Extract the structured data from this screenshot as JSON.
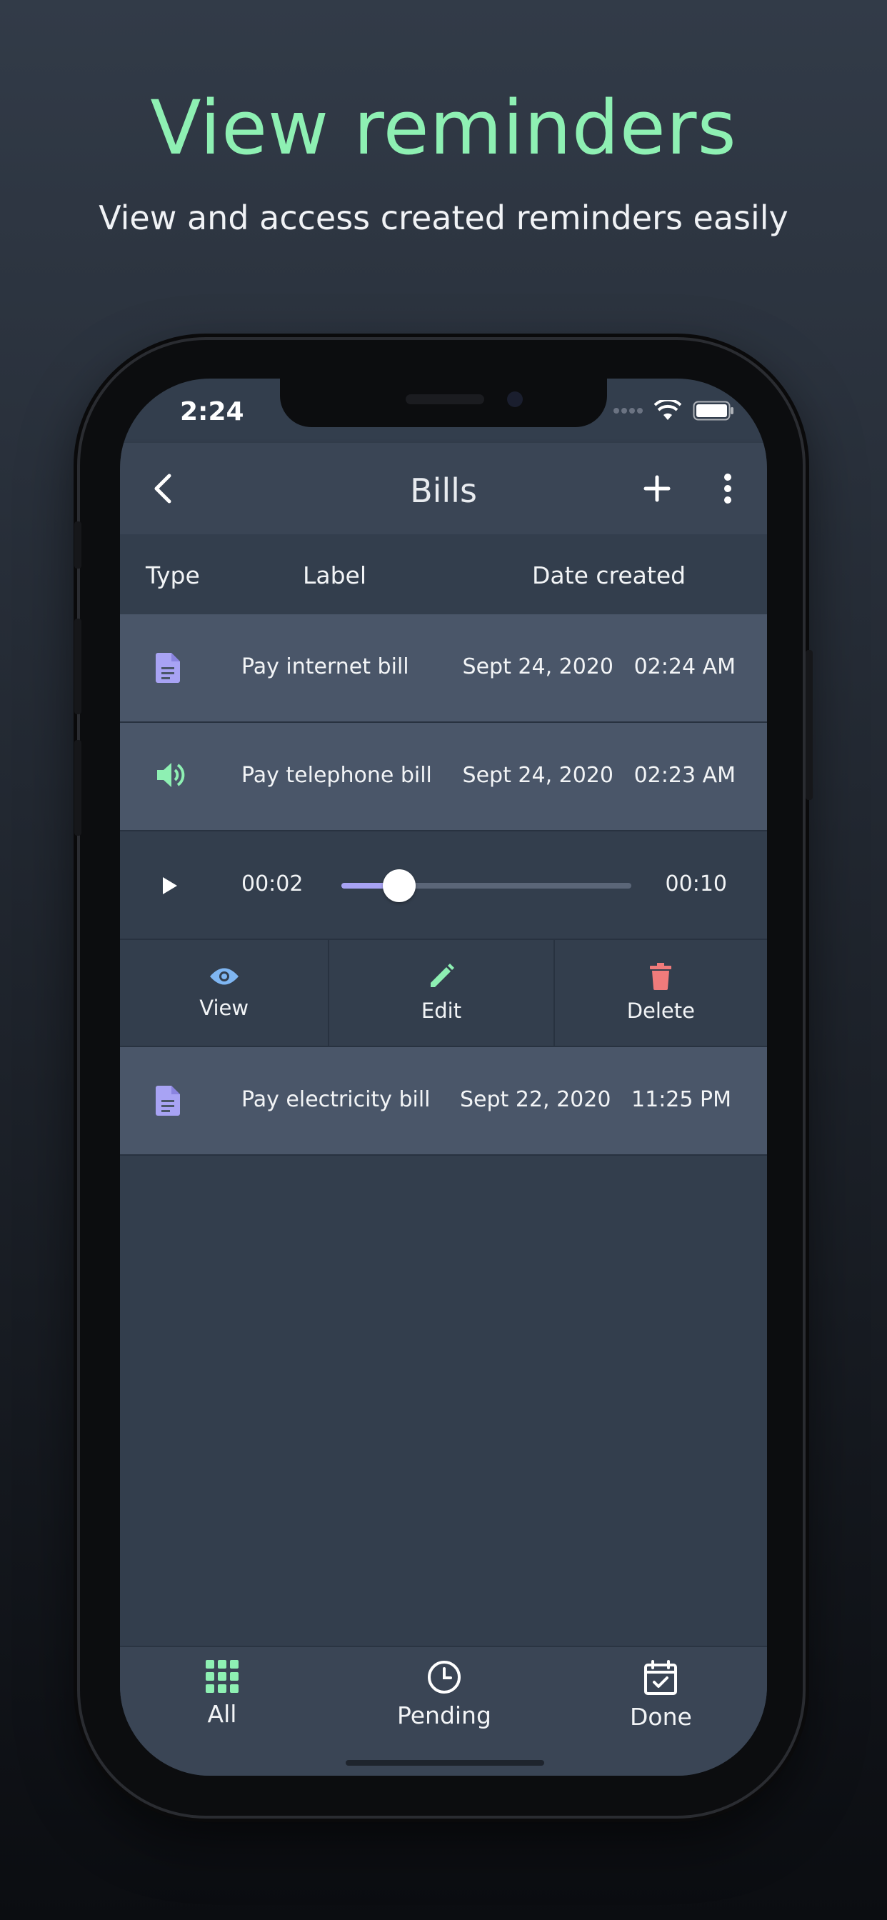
{
  "promo": {
    "title": "View reminders",
    "subtitle": "View and access created reminders easily"
  },
  "status_bar": {
    "time": "2:24"
  },
  "app_bar": {
    "title": "Bills",
    "back_icon": "chevron-left-icon",
    "add_icon": "plus-icon",
    "menu_icon": "more-vertical-icon"
  },
  "table": {
    "headers": {
      "type": "Type",
      "label": "Label",
      "date": "Date created"
    },
    "rows": [
      {
        "type_icon": "document-icon",
        "label": "Pay internet bill",
        "date": "Sept 24, 2020   02:24 AM"
      },
      {
        "type_icon": "speaker-icon",
        "label": "Pay telephone bill",
        "date": "Sept 24, 2020   02:23 AM"
      },
      {
        "type_icon": "document-icon",
        "label": "Pay electricity bill",
        "date": "Sept 22, 2020   11:25 PM"
      }
    ]
  },
  "player": {
    "current": "00:02",
    "total": "00:10",
    "progress": 0.2
  },
  "actions": {
    "view": "View",
    "edit": "Edit",
    "delete": "Delete"
  },
  "bottom_nav": {
    "all": "All",
    "pending": "Pending",
    "done": "Done"
  },
  "colors": {
    "accent_green": "#8ef0b3",
    "doc_icon": "#a8a3f4",
    "speaker_icon": "#8ef0b3",
    "view_icon": "#7fb6f2",
    "edit_icon": "#8ef0b3",
    "delete_icon": "#f07b7b"
  }
}
